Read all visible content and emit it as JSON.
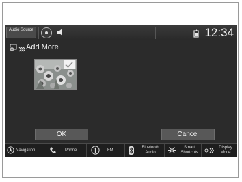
{
  "status_bar": {
    "audio_source_label": "Audio Source",
    "time": "12:34"
  },
  "title_bar": {
    "title": "Add More"
  },
  "buttons": {
    "ok_label": "OK",
    "cancel_label": "Cancel"
  },
  "nav": {
    "items": [
      {
        "label": "Navigation",
        "icon": "navigation-icon"
      },
      {
        "label": "Phone",
        "icon": "phone-icon"
      },
      {
        "label": "FM",
        "icon": "radio-icon"
      },
      {
        "label": "Bluetooth Audio",
        "icon": "bluetooth-icon"
      },
      {
        "label": "Smart Shortcuts",
        "icon": "smart-shortcuts-icon"
      },
      {
        "label": "Display Mode",
        "icon": "display-mode-icon"
      }
    ]
  },
  "colors": {
    "screen_background": "#2b2b2b",
    "button_background": "#585858",
    "text": "#f0f0f0"
  }
}
